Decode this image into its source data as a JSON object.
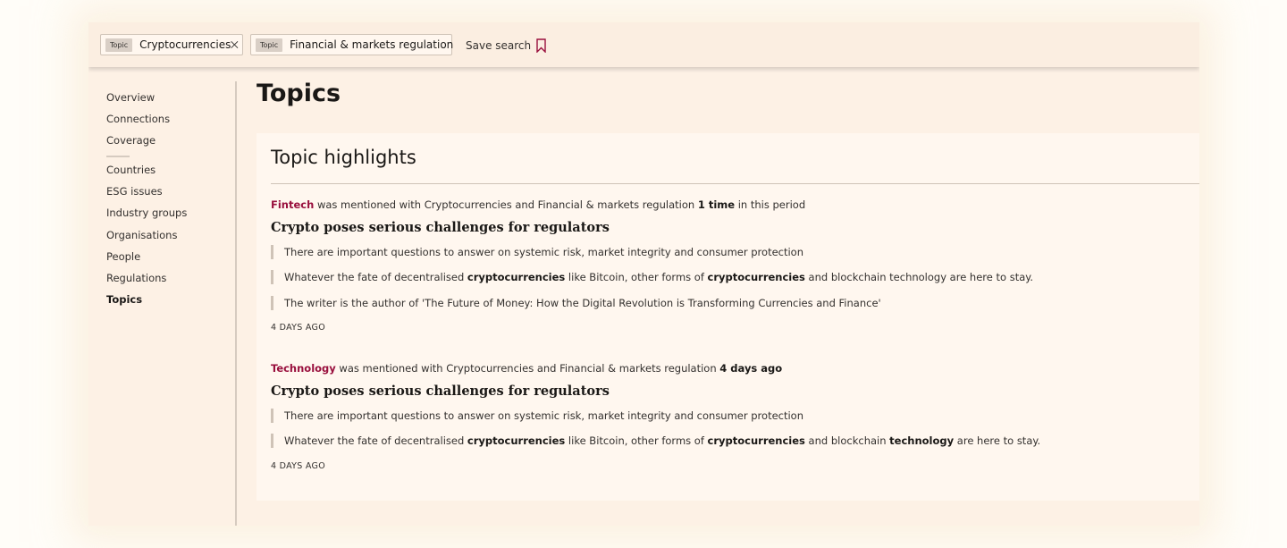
{
  "filters": {
    "chips": [
      {
        "tag": "Topic",
        "label": "Cryptocurrencies"
      },
      {
        "tag": "Topic",
        "label": "Financial & markets regulation"
      }
    ],
    "save_label": "Save search"
  },
  "sidebar": {
    "group1": [
      "Overview",
      "Connections",
      "Coverage"
    ],
    "group2": [
      "Countries",
      "ESG issues",
      "Industry groups",
      "Organisations",
      "People",
      "Regulations",
      "Topics"
    ],
    "active": "Topics"
  },
  "page": {
    "title": "Topics"
  },
  "panel": {
    "title": "Topic highlights",
    "items": [
      {
        "link": "Fintech",
        "mid": " was mentioned with Cryptocurrencies and Financial & markets regulation ",
        "count": "1 time",
        "suffix": " in this period",
        "headline": "Crypto poses serious challenges for regulators",
        "snippets": [
          [
            {
              "t": "There are important questions to answer on systemic risk, market integrity and consumer protection",
              "b": false
            }
          ],
          [
            {
              "t": "Whatever the fate of decentralised ",
              "b": false
            },
            {
              "t": "cryptocurrencies",
              "b": true
            },
            {
              "t": " like Bitcoin, other forms of ",
              "b": false
            },
            {
              "t": "cryptocurrencies",
              "b": true
            },
            {
              "t": " and blockchain technology are here to stay.",
              "b": false
            }
          ],
          [
            {
              "t": "The writer is the author of 'The Future of Money: How the Digital Revolution is Transforming Currencies and Finance'",
              "b": false
            }
          ]
        ],
        "ago": "4 DAYS AGO"
      },
      {
        "link": "Technology",
        "mid": " was mentioned with Cryptocurrencies and Financial & markets regulation ",
        "count": "4 days ago",
        "suffix": "",
        "headline": "Crypto poses serious challenges for regulators",
        "snippets": [
          [
            {
              "t": "There are important questions to answer on systemic risk, market integrity and consumer protection",
              "b": false
            }
          ],
          [
            {
              "t": "Whatever the fate of decentralised ",
              "b": false
            },
            {
              "t": "cryptocurrencies",
              "b": true
            },
            {
              "t": " like Bitcoin, other forms of ",
              "b": false
            },
            {
              "t": "cryptocurrencies",
              "b": true
            },
            {
              "t": " and blockchain ",
              "b": false
            },
            {
              "t": "technology",
              "b": true
            },
            {
              "t": " are here to stay.",
              "b": false
            }
          ]
        ],
        "ago": "4 DAYS AGO"
      }
    ]
  },
  "colors": {
    "accent": "#990f3d",
    "background": "#fdf1e5",
    "panel": "#fff7ef"
  },
  "icons": {
    "chip_remove": "close-icon",
    "save": "bookmark-icon"
  }
}
